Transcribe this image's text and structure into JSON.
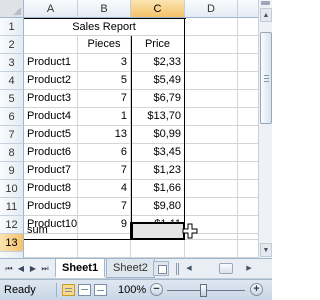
{
  "columns": [
    "A",
    "B",
    "C",
    "D"
  ],
  "selected_column": "C",
  "rows": [
    "1",
    "2",
    "3",
    "4",
    "5",
    "6",
    "7",
    "8",
    "9",
    "10",
    "11",
    "12",
    "13"
  ],
  "selected_row": "13",
  "title": "Sales Report",
  "headers": {
    "pieces": "Pieces",
    "price": "Price"
  },
  "products": [
    {
      "name": "Product1",
      "pieces": "3",
      "price": "$2,33"
    },
    {
      "name": "Product2",
      "pieces": "5",
      "price": "$5,49"
    },
    {
      "name": "Product3",
      "pieces": "7",
      "price": "$6,79"
    },
    {
      "name": "Product4",
      "pieces": "1",
      "price": "$13,70"
    },
    {
      "name": "Product5",
      "pieces": "13",
      "price": "$0,99"
    },
    {
      "name": "Product6",
      "pieces": "6",
      "price": "$3,45"
    },
    {
      "name": "Product7",
      "pieces": "7",
      "price": "$1,23"
    },
    {
      "name": "Product8",
      "pieces": "4",
      "price": "$1,66"
    },
    {
      "name": "Product9",
      "pieces": "7",
      "price": "$9,80"
    },
    {
      "name": "Product10",
      "pieces": "9",
      "price": "$1,11"
    }
  ],
  "sum_label": "sum",
  "selected_cell": "C13",
  "sheet_tabs": [
    {
      "label": "Sheet1",
      "active": true
    },
    {
      "label": "Sheet2",
      "active": false
    }
  ],
  "status": {
    "ready": "Ready",
    "zoom": "100%",
    "zoom_minus": "−",
    "zoom_plus": "+"
  },
  "colors": {
    "header_selected": "#f5c26b",
    "gridline": "#d4d4d4",
    "selected_cell_fill": "#e6e6e6"
  }
}
